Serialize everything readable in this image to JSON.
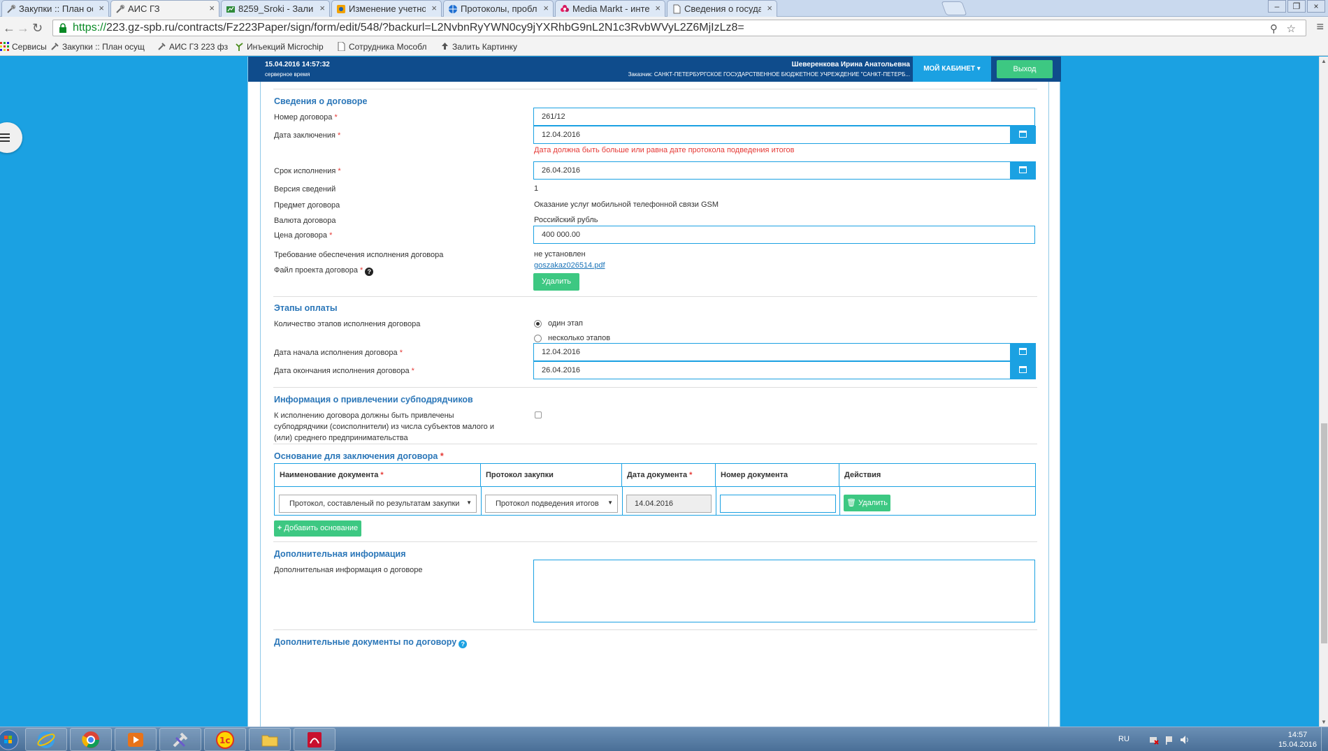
{
  "browser": {
    "tabs": [
      {
        "label": "Закупки :: План осуществл",
        "icon": "tools-icon"
      },
      {
        "label": "АИС ГЗ",
        "icon": "tools-icon",
        "active": true
      },
      {
        "label": "8259_Sroki - Заливка удал",
        "icon": "sheet-icon"
      },
      {
        "label": "Изменение учетной запис",
        "icon": "settings-icon"
      },
      {
        "label": "Протоколы, проблема пр",
        "icon": "globe-icon"
      },
      {
        "label": "Media Markt - интернет-м",
        "icon": "flower-icon"
      },
      {
        "label": "Сведения о государствен",
        "icon": "document-icon"
      }
    ],
    "url_scheme": "https://",
    "url_rest": "223.gz-spb.ru/contracts/Fz223Paper/sign/form/edit/548/?backurl=L2NvbnRyYWN0cy9jYXRhbG9nL2N1c3RvbWVyL2Z6MjIzLz8=",
    "bookmarks": [
      {
        "label": "Сервисы",
        "icon": "apps-icon"
      },
      {
        "label": "Закупки :: План осущ",
        "icon": "tools-icon"
      },
      {
        "label": "АИС ГЗ 223 фз",
        "icon": "tools-icon"
      },
      {
        "label": "Инъекций Microchip",
        "icon": "plant-icon"
      },
      {
        "label": "Сотрудника Мособл",
        "icon": "document-icon"
      },
      {
        "label": "Залить Картинку",
        "icon": "upload-icon"
      }
    ]
  },
  "header": {
    "datetime": "15.04.2016 14:57:32",
    "time_note": "серверное время",
    "user_name": "Шеверенкова Ирина Анатольевна",
    "customer": "Заказчик: САНКТ-ПЕТЕРБУРГСКОЕ ГОСУДАРСТВЕННОЕ БЮДЖЕТНОЕ УЧРЕЖДЕНИЕ \"САНКТ-ПЕТЕРБ...",
    "cabinet_label": "МОЙ КАБИНЕТ",
    "exit_label": "Выход"
  },
  "contract": {
    "title": "Сведения о договоре",
    "number_label": "Номер договора",
    "number_value": "261/12",
    "date_label": "Дата заключения",
    "date_value": "12.04.2016",
    "date_error": "Дата должна быть больше или равна дате протокола подведения итогов",
    "term_label": "Срок исполнения",
    "term_value": "26.04.2016",
    "version_label": "Версия сведений",
    "version_value": "1",
    "subject_label": "Предмет договора",
    "subject_value": "Оказание услуг мобильной телефонной связи GSM",
    "currency_label": "Валюта договора",
    "currency_value": "Российский рубль",
    "price_label": "Цена договора",
    "price_value": "400 000.00",
    "security_label": "Требование обеспечения исполнения договора",
    "security_value": "не установлен",
    "file_label": "Файл проекта договора",
    "file_name": "goszakaz026514.pdf",
    "delete_label": "Удалить"
  },
  "payment": {
    "title": "Этапы оплаты",
    "stages_label": "Количество этапов исполнения договора",
    "option_one": "один этап",
    "option_many": "несколько этапов",
    "start_label": "Дата начала исполнения договора",
    "start_value": "12.04.2016",
    "end_label": "Дата окончания исполнения договора",
    "end_value": "26.04.2016"
  },
  "subcontract": {
    "title": "Информация о привлечении субподрядчиков",
    "line1": "К исполнению договора должны быть привлечены",
    "line2": "субподрядчики (соисполнители) из числа субъектов малого и",
    "line3": "(или) среднего предпринимательства",
    "checked": false
  },
  "basis": {
    "title": "Основание для заключения договора",
    "columns": [
      "Наименование документа",
      "Протокол закупки",
      "Дата документа",
      "Номер документа",
      "Действия"
    ],
    "row": {
      "doc_name": "Протокол, составленый по результатам закупки",
      "protocol": "Протокол подведения итогов",
      "doc_date": "14.04.2016",
      "doc_number": "",
      "delete_label": "Удалить"
    },
    "add_label": "Добавить основание"
  },
  "additional": {
    "title": "Дополнительная информация",
    "label": "Дополнительная информация о договоре",
    "value": ""
  },
  "extra_docs_title": "Дополнительные документы по договору",
  "taskbar": {
    "lang": "RU",
    "time": "14:57",
    "date": "15.04.2016"
  }
}
